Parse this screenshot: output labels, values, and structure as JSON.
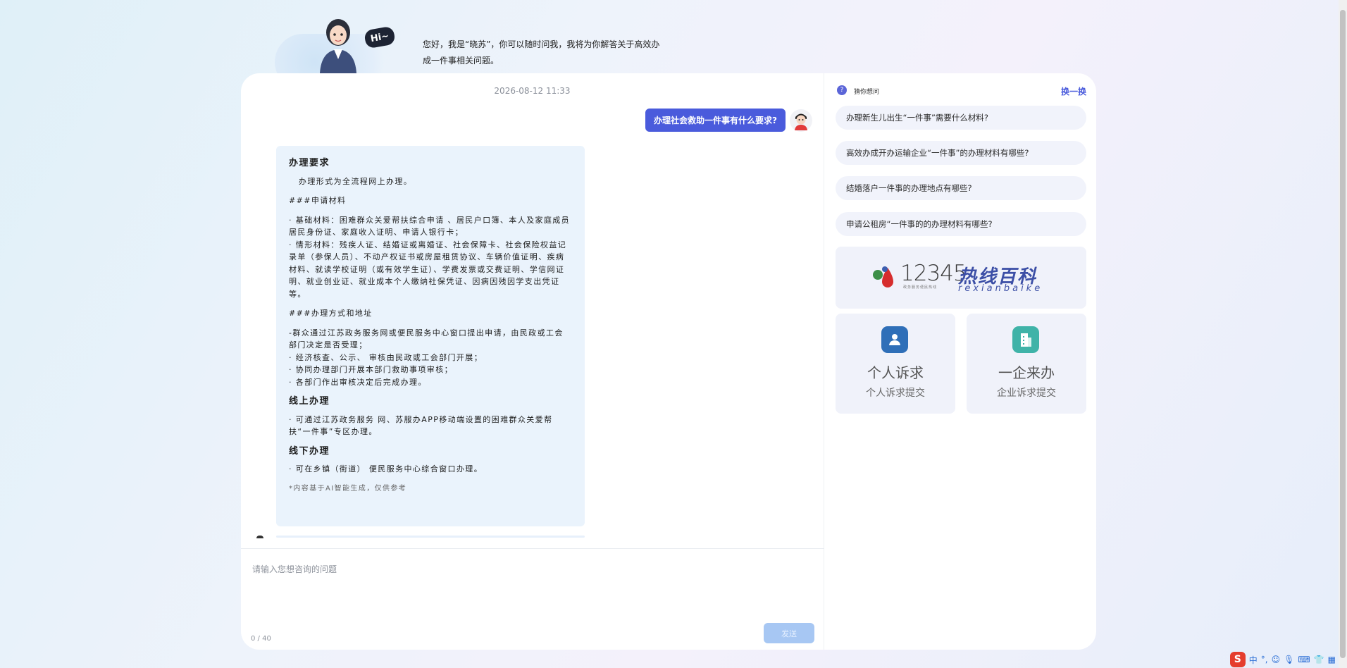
{
  "hero": {
    "hi_text": "Hi~",
    "greeting_line1": "您好，我是“晓苏”，你可以随时问我，我将为你解答关于高效办",
    "greeting_line2": "成一件事相关问题。"
  },
  "chat": {
    "timestamp": "2026-08-12 11:33",
    "user_question": "办理社会救助一件事有什么要求?",
    "answer": {
      "heading_requirements": "办理要求",
      "lead": "办理形式为全流程网上办理。",
      "heading_materials": "###申请材料",
      "material_basic": "·  基础材料：困难群众关爱帮扶综合申请 、居民户口簿、本人及家庭成员居民身份证、家庭收入证明、申请人银行卡；",
      "material_situation": "·  情形材料：残疾人证、结婚证或离婚证、社会保障卡、社会保险权益记录单（参保人员）、不动产权证书或房屋租赁协议、车辆价值证明、疾病材料、就读学校证明（或有效学生证）、学费发票或交费证明、学信网证明、就业创业证、就业成本个人缴纳社保凭证、因病因残因学支出凭证等。",
      "heading_method": "###办理方式和地址",
      "method_1": "-群众通过江苏政务服务网或便民服务中心窗口提出申请，由民政或工会部门决定是否受理；",
      "method_2": "·  经济核查、公示、 审核由民政或工会部门开展；",
      "method_3": "·  协同办理部门开展本部门救助事项审核；",
      "method_4": "·  各部门作出审核决定后完成办理。",
      "heading_online": "线上办理",
      "online_1": "·  可通过江苏政务服务 网、苏服办APP移动端设置的困难群众关爱帮扶“一件事”专区办理。",
      "heading_offline": "线下办理",
      "offline_1": "·  可在乡镇（街道） 便民服务中心综合窗口办理。",
      "disclaimer": "*内容基于AI智能生成，仅供参考"
    }
  },
  "input": {
    "placeholder": "请输入您想咨询的问题",
    "counter": "0 / 40",
    "send_label": "发送"
  },
  "sidebar": {
    "title": "猜你想问",
    "refresh_label": "换一换",
    "suggestions": [
      "办理新生儿出生“一件事”需要什么材料?",
      "高效办成开办运输企业“一件事”的办理材料有哪些?",
      "结婚落户一件事的办理地点有哪些?",
      "申请公租房“一件事的的办理材料有哪些?"
    ],
    "banner": {
      "number": "12345",
      "small_text": "政务服务便民热线",
      "cn_title": "热线百科",
      "en_title": "rexianbaike"
    },
    "tiles": [
      {
        "title": "个人诉求",
        "subtitle": "个人诉求提交",
        "icon": "person-icon",
        "color": "#2f6fb8"
      },
      {
        "title": "一企来办",
        "subtitle": "企业诉求提交",
        "icon": "building-icon",
        "color": "#3fb3a8"
      }
    ]
  },
  "tray": {
    "ime_label": "S",
    "lang": "中",
    "punct": "°,"
  }
}
